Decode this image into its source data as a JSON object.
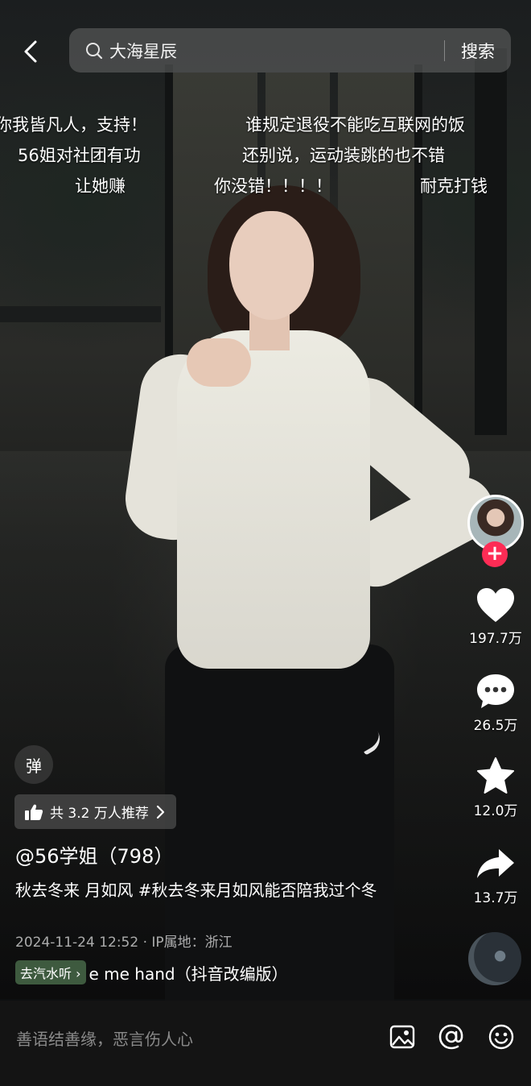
{
  "search": {
    "query": "大海星辰",
    "button_label": "搜索"
  },
  "danmaku": [
    "你我皆凡人，支持！",
    "谁规定退役不能吃互联网的饭",
    "56姐对社团有功",
    "还别说，运动装跳的也不错",
    "让她赚",
    "你没错！！！！",
    "耐克打钱"
  ],
  "actions": {
    "like_count": "197.7万",
    "comment_count": "26.5万",
    "favorite_count": "12.0万",
    "share_count": "13.7万"
  },
  "bottom": {
    "danmu_label": "弹",
    "recommend": "共 3.2 万人推荐",
    "author": "@56学姐（798）",
    "caption": "秋去冬来 月如风 #秋去冬来月如风能否陪我过个冬",
    "meta": "2024-11-24 12:52 · IP属地：浙江",
    "listen_tag": "去汽水听 ›",
    "music": "e me hand（抖音改编版）"
  },
  "comment_bar": {
    "placeholder": "善语结善缘，恶言伤人心"
  },
  "icons": {
    "back": "back-arrow-icon",
    "search": "search-icon",
    "like": "heart-icon",
    "comment": "comment-icon",
    "favorite": "star-icon",
    "share": "share-arrow-icon",
    "image": "image-icon",
    "mention": "at-icon",
    "emoji": "emoji-icon"
  },
  "colors": {
    "accent": "#fe2c55",
    "comment_bar_bg": "#141414",
    "listen_tag_bg": "#3e5a3f"
  }
}
